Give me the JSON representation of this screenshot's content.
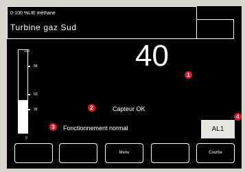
{
  "header": {
    "subtitle": "0-100 %LIE méthane",
    "title": "Turbine gaz Sud",
    "device_id": "L01M01"
  },
  "gauge": {
    "scale_top": "100",
    "scale_bottom": "0",
    "ticks": [
      "88",
      "50",
      "30"
    ],
    "level_percent": 40
  },
  "reading": {
    "value": "40",
    "unit": "%LIE",
    "gas": "CH4"
  },
  "markers": [
    "1",
    "2",
    "3",
    "4"
  ],
  "status": {
    "sensor": "Capteur OK",
    "operation": "Fonctionnement normal"
  },
  "alarm_button": "AL1",
  "softkeys": [
    "",
    "",
    "Menu",
    "",
    "Courbe"
  ],
  "colors": {
    "screen_bg": "#000000",
    "marker_red": "#e3182a",
    "bezel": "#d8d5cf"
  }
}
